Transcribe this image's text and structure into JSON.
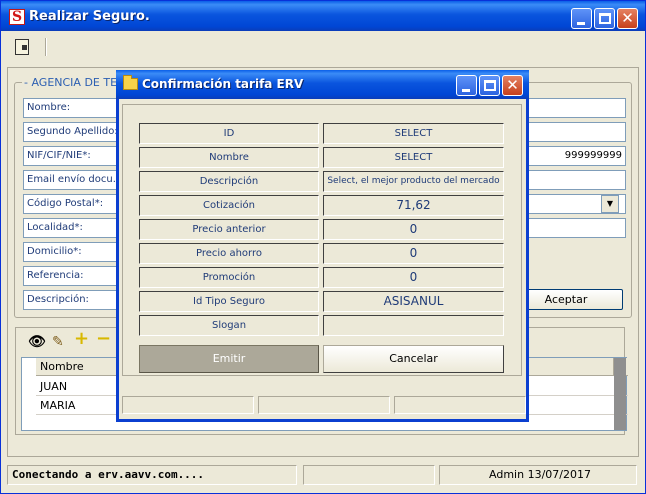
{
  "window": {
    "title": "Realizar Seguro.",
    "app_icon_letter": "S",
    "toolbar_icon": "document-icon"
  },
  "form": {
    "group_label": "- AGENCIA DE TES",
    "fields": [
      {
        "label": "Nombre:",
        "value": ""
      },
      {
        "label": "Segundo Apellido:",
        "value": ""
      },
      {
        "label": "NIF/CIF/NIE*:",
        "value": "999999999"
      },
      {
        "label": "Email envío docu.*:",
        "value": ""
      },
      {
        "label": "Código Postal*:",
        "value": ""
      },
      {
        "label": "Localidad*:",
        "value": ""
      },
      {
        "label": "Domicilio*:",
        "value": ""
      },
      {
        "label": "Referencia:",
        "value": ""
      },
      {
        "label": "Descripción:",
        "value": ""
      }
    ],
    "accept_label": "Aceptar"
  },
  "list": {
    "toolbar_icons": [
      "eye-icon",
      "pencil-icon",
      "plus-icon",
      "minus-icon"
    ],
    "column_header": "Nombre",
    "rows": [
      "JUAN",
      "MARIA"
    ]
  },
  "status": {
    "connection": "Conectando a erv.aavv.com....",
    "user_date": "Admin 13/07/2017"
  },
  "dialog": {
    "title": "Confirmación tarifa ERV",
    "rows": [
      {
        "key": "ID",
        "value": "SELECT"
      },
      {
        "key": "Nombre",
        "value": "SELECT"
      },
      {
        "key": "Descripción",
        "value": "Select, el mejor producto del mercado"
      },
      {
        "key": "Cotización",
        "value": "71,62"
      },
      {
        "key": "Precio anterior",
        "value": "0"
      },
      {
        "key": "Precio ahorro",
        "value": "0"
      },
      {
        "key": "Promoción",
        "value": "0"
      },
      {
        "key": "Id Tipo Seguro",
        "value": "ASISANUL"
      },
      {
        "key": "Slogan",
        "value": ""
      }
    ],
    "emit_label": "Emitir",
    "cancel_label": "Cancelar"
  }
}
